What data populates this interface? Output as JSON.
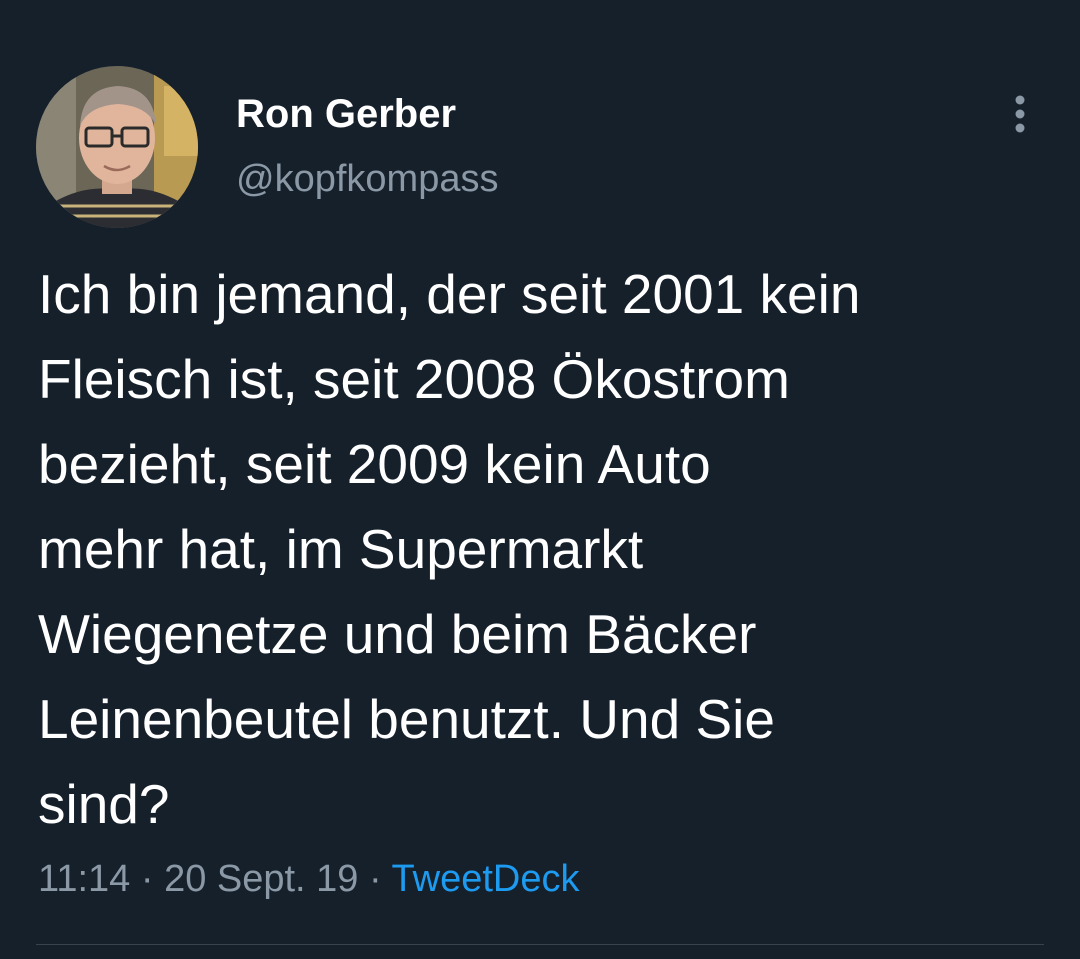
{
  "tweet": {
    "author": {
      "display_name": "Ron Gerber",
      "handle": "@kopfkompass",
      "avatar": "profile-photo"
    },
    "more_icon": "more-options-icon",
    "text": "Ich bin jemand, der seit 2001 kein\nFleisch ist, seit 2008 Ökostrom\nbezieht, seit 2009 kein Auto\nmehr hat, im Supermarkt\nWiegenetze und beim Bäcker\nLeinenbeutel benutzt. Und Sie\nsind?",
    "time": "11:14",
    "separator": "·",
    "date": "20 Sept. 19",
    "source": "TweetDeck"
  },
  "colors": {
    "background": "#15202b",
    "primary_text": "#ffffff",
    "secondary_text": "#8b98a5",
    "link": "#1d9bf0",
    "divider": "#38444d"
  }
}
